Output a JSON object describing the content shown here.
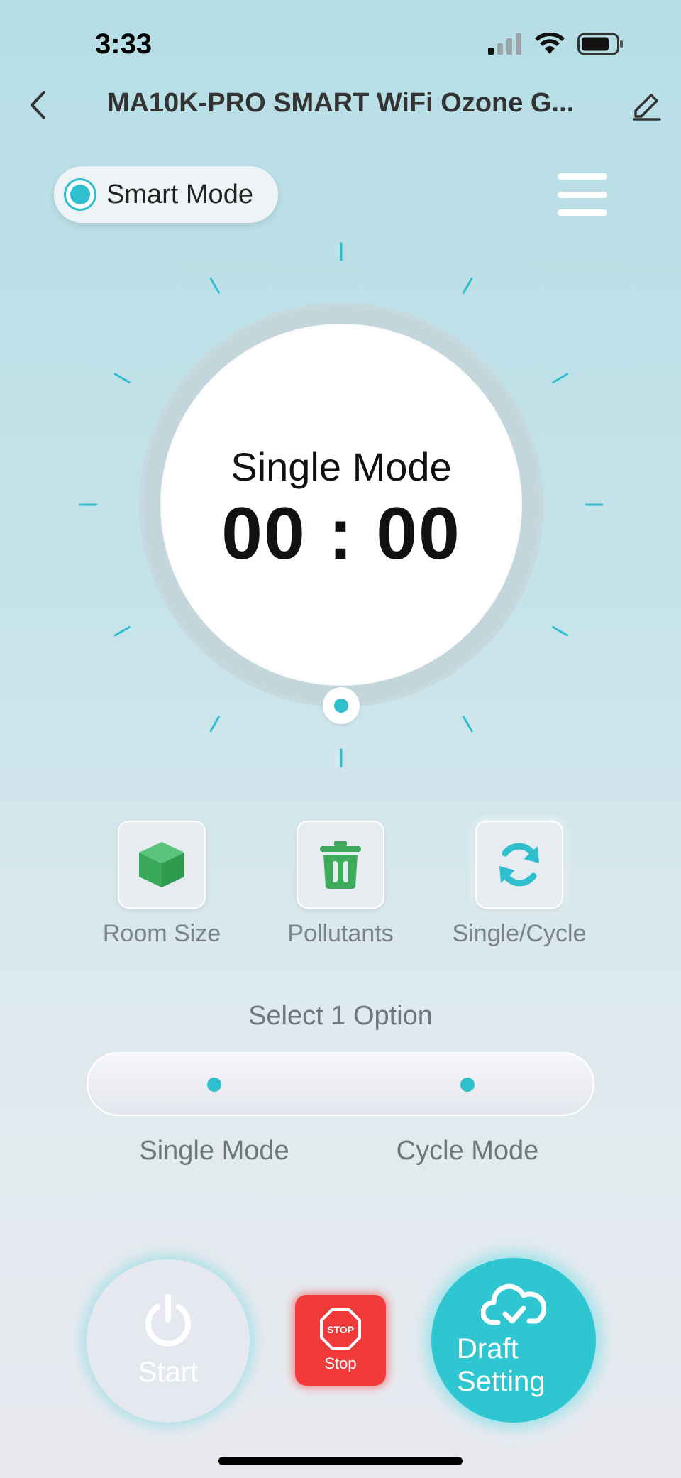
{
  "status_bar": {
    "time": "3:33",
    "signal": "signal-icon",
    "wifi": "wifi-icon",
    "battery": "battery-icon"
  },
  "nav": {
    "title": "MA10K-PRO SMART WiFi Ozone G...",
    "back_icon": "chevron-left-icon",
    "edit_icon": "edit-icon"
  },
  "mode": {
    "label": "Smart Mode",
    "selected": true
  },
  "menu_icon": "menu-icon",
  "dial": {
    "mode_label": "Single Mode",
    "time": "00 : 00"
  },
  "options": [
    {
      "label": "Room Size",
      "icon": "cube-icon"
    },
    {
      "label": "Pollutants",
      "icon": "trash-icon"
    },
    {
      "label": "Single/Cycle",
      "icon": "refresh-icon",
      "active": true
    }
  ],
  "selector": {
    "prompt": "Select 1 Option",
    "choices": [
      "Single Mode",
      "Cycle Mode"
    ]
  },
  "actions": {
    "start_label": "Start",
    "stop_label": "Stop",
    "stop_sign_text": "STOP",
    "draft_label": "Draft Setting"
  },
  "colors": {
    "accent": "#2fbfcf",
    "stop": "#f03a3a",
    "cube": "#3faa5c",
    "trash": "#3faa5c"
  }
}
